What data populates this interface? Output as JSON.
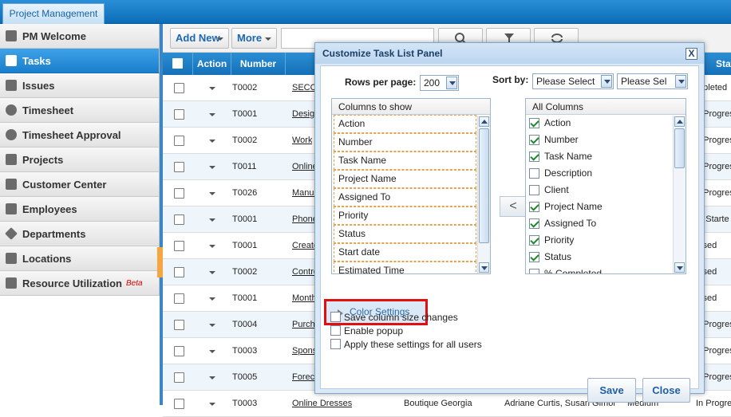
{
  "app": {
    "tab": "Project Management"
  },
  "sidebar": {
    "items": [
      {
        "label": "PM Welcome",
        "icon": "home-icon"
      },
      {
        "label": "Tasks",
        "icon": "tasks-icon",
        "active": true
      },
      {
        "label": "Issues",
        "icon": "issues-icon"
      },
      {
        "label": "Timesheet",
        "icon": "clock-icon"
      },
      {
        "label": "Timesheet Approval",
        "icon": "check-circle-icon"
      },
      {
        "label": "Projects",
        "icon": "folder-icon"
      },
      {
        "label": "Customer Center",
        "icon": "building-icon"
      },
      {
        "label": "Employees",
        "icon": "person-icon"
      },
      {
        "label": "Departments",
        "icon": "cube-icon"
      },
      {
        "label": "Locations",
        "icon": "flag-icon"
      },
      {
        "label": "Resource Utilization",
        "icon": "chart-icon",
        "badge": "Beta"
      }
    ]
  },
  "toolbar": {
    "add_new": "Add New",
    "more": "More"
  },
  "grid": {
    "headers": {
      "action": "Action",
      "number": "Number",
      "status": "Stat"
    },
    "rows": [
      {
        "number": "T0002",
        "name": "SECO",
        "status": "mpleted"
      },
      {
        "number": "T0001",
        "name": "Desig",
        "status": "n Progres"
      },
      {
        "number": "T0002",
        "name": "Work",
        "status": "n Progres"
      },
      {
        "number": "T0011",
        "name": "Online",
        "status": "n Progres"
      },
      {
        "number": "T0026",
        "name": "Manua",
        "status": "n Progres"
      },
      {
        "number": "T0001",
        "name": "Phone",
        "status": "ot Starte"
      },
      {
        "number": "T0001",
        "name": "Create",
        "status": "losed"
      },
      {
        "number": "T0002",
        "name": "Contro",
        "status": "losed"
      },
      {
        "number": "T0001",
        "name": "Month",
        "status": "losed"
      },
      {
        "number": "T0004",
        "name": "Purcha",
        "status": "n Progres"
      },
      {
        "number": "T0003",
        "name": "Sponse",
        "status": "n Progres"
      },
      {
        "number": "T0005",
        "name": "Forec",
        "status": "n Progres"
      },
      {
        "number": "T0003",
        "name": "Online Dresses",
        "project": "Boutique Georgia",
        "assigned": "Adriane Curtis, Susan Gimon",
        "priority": "Medium",
        "status": "In Progres"
      }
    ]
  },
  "dialog": {
    "title": "Customize Task List Panel",
    "close": "X",
    "rows_per_page_label": "Rows per page:",
    "rows_per_page_value": "200",
    "sort_by_label": "Sort by:",
    "sort_first": "Please Select",
    "sort_second": "Please Sel",
    "columns_to_show_label": "Columns to show",
    "columns_to_show": [
      "Action",
      "Number",
      "Task Name",
      "Project Name",
      "Assigned To",
      "Priority",
      "Status",
      "Start date",
      "Estimated Time"
    ],
    "all_columns_label": "All Columns",
    "all_columns": [
      {
        "label": "Action",
        "checked": true
      },
      {
        "label": "Number",
        "checked": true
      },
      {
        "label": "Task Name",
        "checked": true
      },
      {
        "label": "Description",
        "checked": false
      },
      {
        "label": "Client",
        "checked": false
      },
      {
        "label": "Project Name",
        "checked": true
      },
      {
        "label": "Assigned To",
        "checked": true
      },
      {
        "label": "Priority",
        "checked": true
      },
      {
        "label": "Status",
        "checked": true
      },
      {
        "label": "% Completed",
        "checked": false
      }
    ],
    "move_left": "<",
    "color_settings": "Color Settings",
    "options": [
      "Save column size changes",
      "Enable popup",
      "Apply these settings for all users"
    ],
    "save": "Save",
    "close_button": "Close"
  }
}
